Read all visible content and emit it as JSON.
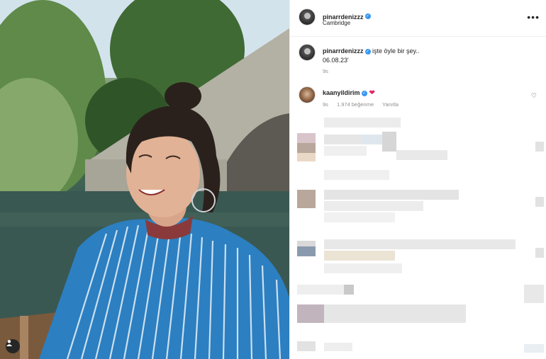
{
  "post": {
    "author": "pinarrdenizzz",
    "location": "Cambridge",
    "caption_text": "işte öyle bir şey..",
    "caption_date": "06.08.23'",
    "caption_time": "9s"
  },
  "comment": {
    "author": "kaanyildirim",
    "time": "9s",
    "likes": "1.974 beğenme",
    "reply_label": "Yanıtla"
  },
  "icons": {
    "more": "more-options-icon",
    "like": "heart-outline-icon",
    "verified": "verified-badge-icon",
    "user_tag": "user-tag-icon"
  },
  "colors": {
    "verified": "#3897f0",
    "heart": "#e0245e",
    "secondary_text": "#8e8e8e"
  }
}
